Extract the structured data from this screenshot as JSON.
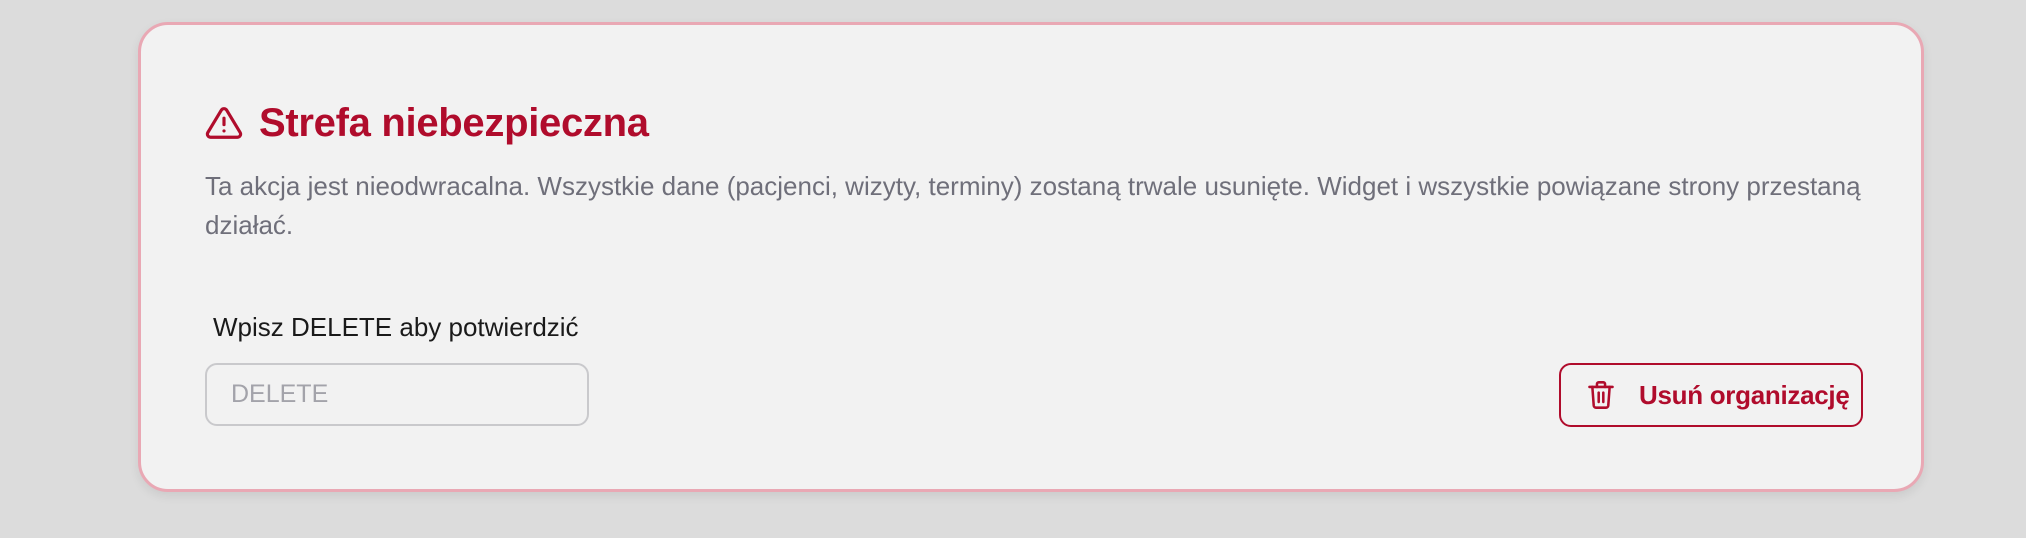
{
  "danger_zone": {
    "title": "Strefa niebezpieczna",
    "icon": "warning-triangle-icon",
    "description": "Ta akcja jest nieodwracalna. Wszystkie dane (pacjenci, wizyty, terminy) zostaną trwale usunięte. Widget i wszystkie powiązane strony przestaną działać.",
    "confirm_label": "Wpisz DELETE aby potwierdzić",
    "confirm_input": {
      "value": "",
      "placeholder": "DELETE"
    },
    "delete_button": {
      "label": "Usuń organizację",
      "icon": "trash-icon"
    }
  },
  "colors": {
    "accent": "#b00c2c",
    "panel_border": "#e9a8b4",
    "panel_background": "#f2f2f2",
    "page_background": "#dcdcdc",
    "description_text": "#6f6f7a"
  }
}
